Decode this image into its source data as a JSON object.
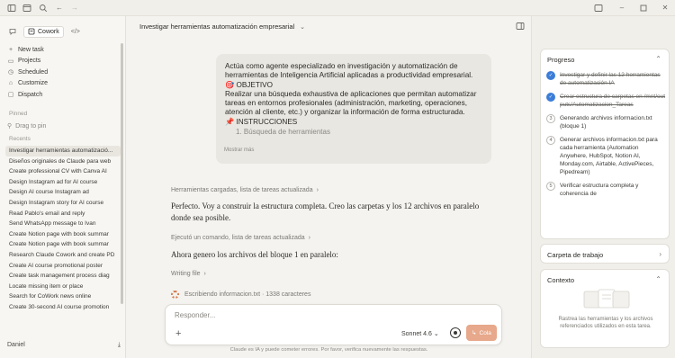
{
  "topbar": {
    "icons": [
      "sidebar-toggle-icon",
      "window-icon",
      "search-icon",
      "back-arrow-icon",
      "forward-arrow-icon"
    ]
  },
  "sidebar": {
    "tabs": [
      {
        "label": "",
        "icon": "chat-icon"
      },
      {
        "label": "Cowork",
        "icon": "cowork-icon"
      },
      {
        "label": "",
        "icon": "code-icon"
      }
    ],
    "nav": [
      {
        "label": "New task",
        "icon": "plus-icon"
      },
      {
        "label": "Projects",
        "icon": "folder-icon"
      },
      {
        "label": "Scheduled",
        "icon": "clock-icon"
      },
      {
        "label": "Customize",
        "icon": "customize-icon"
      },
      {
        "label": "Dispatch",
        "icon": "dispatch-icon"
      }
    ],
    "pinned_label": "Pinned",
    "pin_hint": "Drag to pin",
    "recents_label": "Recents",
    "recents": [
      "Investigar herramientas automatizació...",
      "Diseños originales de Claude para web",
      "Create professional CV with Canva AI",
      "Design Instagram ad for AI course",
      "Design AI course Instagram ad",
      "Design Instagram story for AI course",
      "Read Pablo's email and reply",
      "Send WhatsApp message to Ivan",
      "Create Notion page with book summar",
      "Create Notion page with book summar",
      "Research Claude Cowork and create PD",
      "Create AI course promotional poster",
      "Create task management process diag",
      "Locate missing item or place",
      "Search for CoWork news online",
      "Create 30-second AI course promotion"
    ],
    "user_name": "Daniel"
  },
  "main": {
    "title": "Investigar herramientas automatización empresarial",
    "prompt_lines": [
      "Actúa como agente especializado en investigación y automatización de",
      "herramientas de Inteligencia Artificial aplicadas a productividad empresarial.",
      "🎯 OBJETIVO",
      "Realizar una búsqueda exhaustiva de aplicaciones que permitan automatizar",
      "tareas en entornos profesionales (administración, marketing, operaciones,",
      "atención al cliente, etc.) y organizar la información de forma estructurada.",
      "📌 INSTRUCCIONES"
    ],
    "prompt_subitem": "1. Búsqueda de herramientas",
    "show_more": "Mostrar más",
    "step1": "Herramientas cargadas, lista de tareas actualizada",
    "response1": "Perfecto. Voy a construir la estructura completa. Creo las carpetas y los 12 archivos en paralelo donde sea posible.",
    "step2": "Ejecutó un comando, lista de tareas actualizada",
    "response2": "Ahora genero los archivos del bloque 1 en paralelo:",
    "step3": "Writing file",
    "writing_status": "Escribiendo informacion.txt · 1338 caracteres",
    "composer_placeholder": "Responder...",
    "model": "Sonnet 4.6",
    "queue_label": "Cola",
    "disclaimer": "Claude es IA y puede cometer errores. Por favor, verifica nuevamente las respuestas."
  },
  "right_panel": {
    "progress_title": "Progreso",
    "progress_items": [
      {
        "badge": "✓",
        "status": "done",
        "text": "Investigar y definir las 12 herramientas de automatización IA"
      },
      {
        "badge": "✓",
        "status": "done",
        "text": "Crear estructura de carpetas en /mnt/outputs/Automatizacion_Tareas"
      },
      {
        "badge": "3",
        "status": "pending",
        "text": "Generando archivos informacion.txt (bloque 1)"
      },
      {
        "badge": "4",
        "status": "pending",
        "text": "Generar archivos informacion.txt para cada herramienta (Automation Anywhere, HubSpot, Notion AI, Monday.com, Airtable, ActivePieces, Pipedream)"
      },
      {
        "badge": "5",
        "status": "pending",
        "text": "Verificar estructura completa y coherencia de"
      }
    ],
    "workfolder_title": "Carpeta de trabajo",
    "context_title": "Contexto",
    "context_text": "Rastrea las herramientas y los archivos referenciados utilizados en esta tarea."
  }
}
